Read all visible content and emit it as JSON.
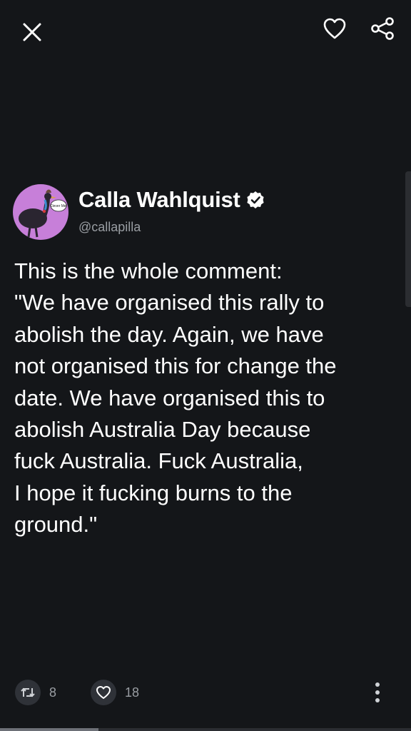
{
  "top_bar": {
    "close_icon": "close-icon",
    "like_icon": "heart-outline-icon",
    "share_icon": "share-icon"
  },
  "author": {
    "name": "Calla Wahlquist",
    "handle": "@callapilla",
    "verified": true,
    "avatar_bg": "#c77fd9",
    "avatar_bubble_text": "Clever Me!"
  },
  "tweet": {
    "lines": [
      "This is the whole comment:",
      "\"We have organised this rally to",
      "abolish the day. Again, we have",
      "not organised this for change the",
      "date. We have organised this to",
      "abolish Australia Day because",
      "fuck Australia. Fuck Australia,",
      "I hope it fucking burns to the",
      "ground.\""
    ]
  },
  "actions": {
    "retweet_count": "8",
    "like_count": "18",
    "retweet_icon": "retweet-icon",
    "like_icon": "heart-outline-icon",
    "more_icon": "more-vertical-icon"
  },
  "progress": {
    "fraction": 0.24
  },
  "colors": {
    "background": "#141619",
    "text": "#ffffff",
    "muted": "#9a9ea3",
    "chip": "#2f3238"
  }
}
